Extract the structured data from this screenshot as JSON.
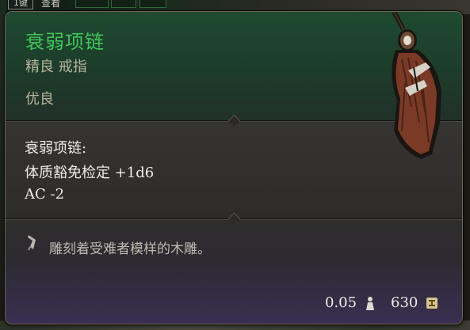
{
  "hud": {
    "hotkey_label": "1键",
    "hotkey_extra": "查看"
  },
  "item": {
    "name": "衰弱项链",
    "type": "精良 戒指",
    "rarity": "优良",
    "name_color": "#41c45a"
  },
  "effects": {
    "header": "衰弱项链:",
    "lines": [
      "体质豁免检定 +1d6",
      "AC -2"
    ]
  },
  "description": {
    "icon": "feather-quill-icon",
    "text": "雕刻着受难者模样的木雕。"
  },
  "footer": {
    "weight": "0.05",
    "weight_icon": "weight-icon",
    "price": "630",
    "price_icon": "gold-coin-icon"
  },
  "colors": {
    "header_bg": "#1f4a30",
    "desc_bg_bottom": "#3a2f52",
    "body_text": "#ecebe6",
    "muted_text": "#b9b39c"
  }
}
